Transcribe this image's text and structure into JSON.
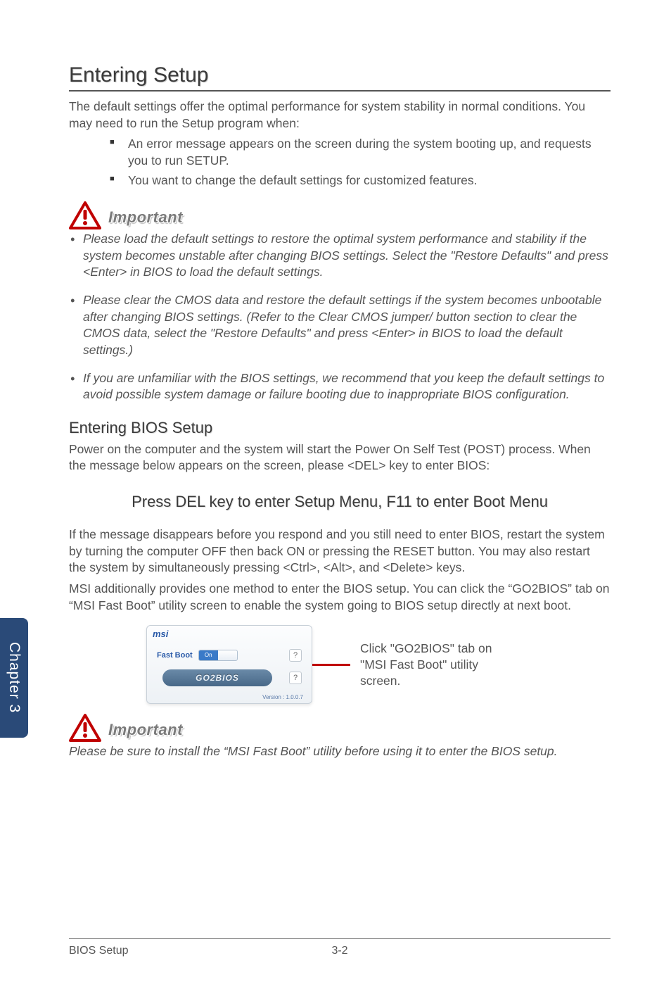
{
  "h1": "Entering Setup",
  "intro": "The default settings offer the optimal performance for system stability in normal conditions. You may need to run the Setup program when:",
  "intro_bullets": [
    "An error message appears on the screen during the system booting up, and requests you to run SETUP.",
    "You want to change the default settings for customized features."
  ],
  "important_label": "Important",
  "important_bullets": [
    "Please load the default settings to restore the optimal system performance and stability if the system becomes unstable after changing BIOS settings. Select the \"Restore Defaults\" and press <Enter> in BIOS to load the default settings.",
    "Please clear the CMOS data and restore the default settings if the system becomes unbootable after changing BIOS settings. (Refer to the Clear CMOS jumper/ button section to clear the CMOS data, select the \"Restore Defaults\" and press <Enter> in BIOS to load the default settings.)",
    "If you are unfamiliar with the BIOS settings, we recommend that you keep the default settings to avoid possible system damage or failure booting due to inappropriate BIOS configuration."
  ],
  "h2": "Entering BIOS Setup",
  "post_text": "Power on the computer and the system will start the Power On Self Test (POST) process. When the message below appears on the screen, please <DEL> key to enter BIOS:",
  "press_del": "Press DEL key to enter Setup Menu, F11 to enter Boot Menu",
  "after_msg_1": "If the message disappears before you respond and you still need to enter BIOS, restart the system by turning the computer OFF then back ON or pressing the RESET button. You may also restart the system by simultaneously pressing <Ctrl>, <Alt>, and <Delete> keys.",
  "after_msg_2": "MSI additionally provides one method to enter the BIOS setup. You can click the “GO2BIOS” tab on “MSI Fast Boot” utility screen to enable the system going to BIOS setup directly at next boot.",
  "fastboot": {
    "brand": "msi",
    "label": "Fast Boot",
    "toggle_on": "On",
    "toggle_off": "",
    "go2bios": "GO2BIOS",
    "help": "?",
    "version": "Version : 1.0.0.7"
  },
  "caption": "Click \"GO2BIOS\" tab on \"MSI Fast Boot\" utility screen.",
  "important2_text": "Please be sure to install the “MSI Fast Boot” utility before using it to enter the BIOS setup.",
  "side_tab": "Chapter 3",
  "footer_left": "BIOS Setup",
  "footer_page": "3-2"
}
